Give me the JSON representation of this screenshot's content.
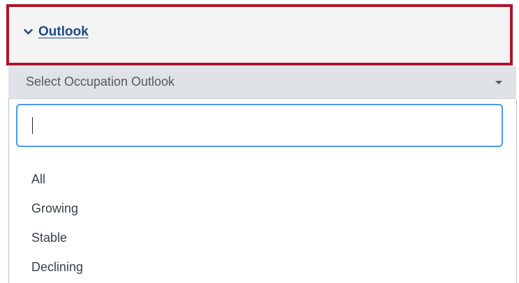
{
  "accordion": {
    "title": "Outlook",
    "expanded": true
  },
  "select": {
    "placeholder": "Select Occupation Outlook",
    "search_value": ""
  },
  "options": [
    "All",
    "Growing",
    "Stable",
    "Declining"
  ],
  "colors": {
    "highlight_border": "#b0122d",
    "link": "#1f4b83",
    "focus_border": "#4a9be8",
    "select_bg": "#dfe3e8"
  },
  "icons": {
    "toggle": "chevron-down-icon",
    "dropdown": "caret-down-icon"
  }
}
